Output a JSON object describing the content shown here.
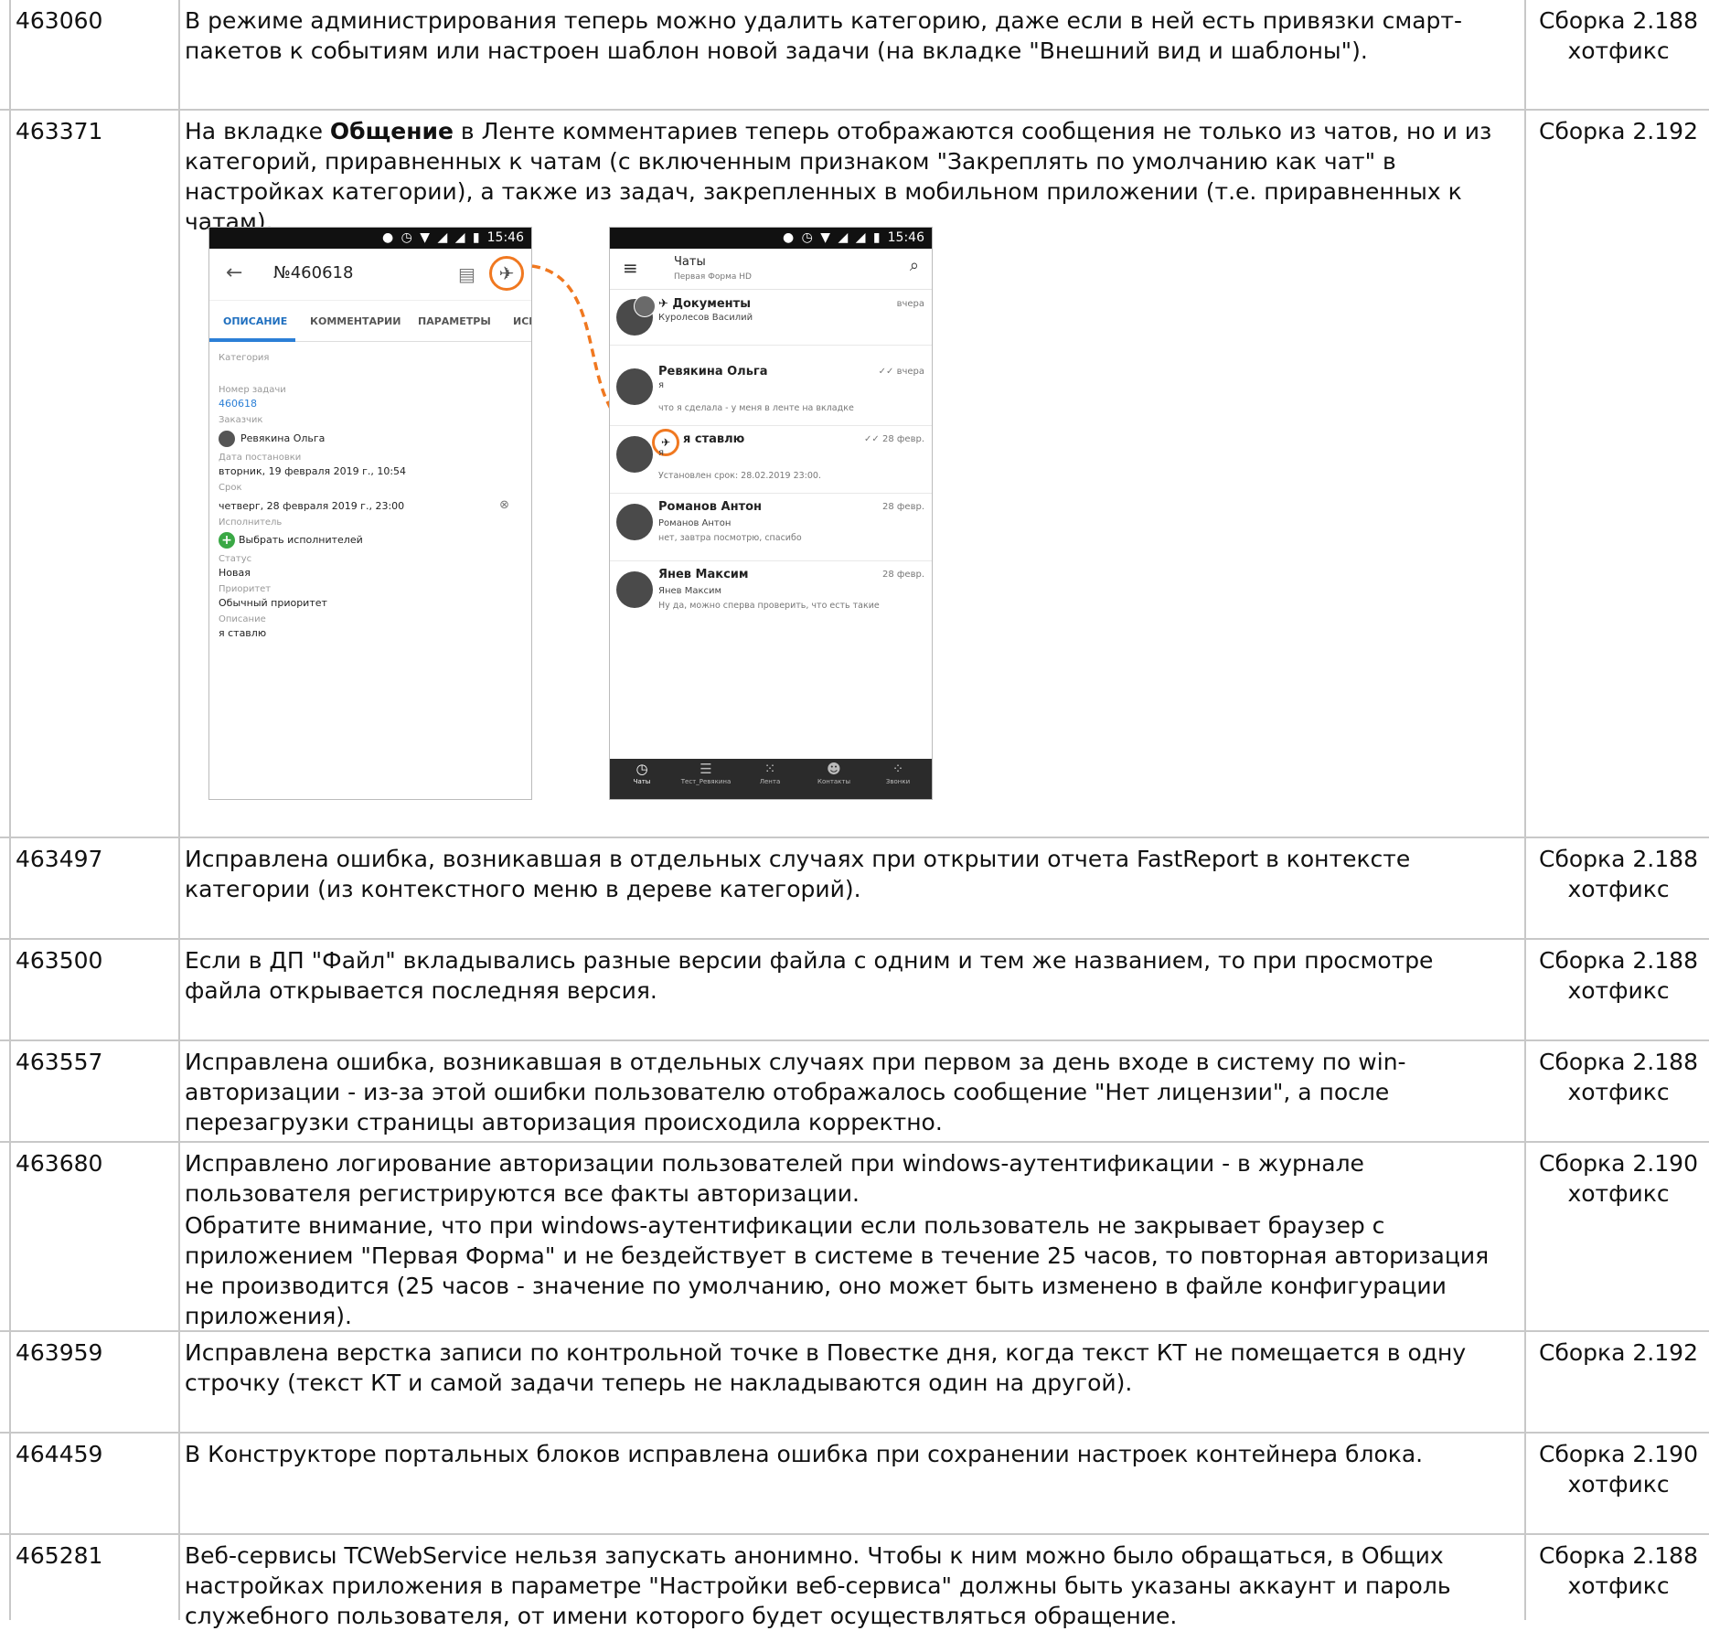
{
  "rows": [
    {
      "id": "463060",
      "desc": [
        "В режиме администрирования теперь можно удалить категорию, даже если в ней есть привязки смарт-пакетов к событиям или настроен шаблон новой задачи (на вкладке \"Внешний вид и шаблоны\")."
      ],
      "build": "Сборка 2.188",
      "note": "хотфикс"
    },
    {
      "id": "463371",
      "desc_pre": "На вкладке ",
      "desc_bold": "Общение",
      "desc_post": " в Ленте комментариев теперь отображаются сообщения не только из чатов, но и из категорий, приравненных к чатам (с включенным признаком \"Закреплять по умолчанию как чат\" в настройках категории), а также из задач, закрепленных в мобильном приложении (т.е. приравненных к чатам).",
      "build": "Сборка 2.192",
      "note": ""
    },
    {
      "id": "463497",
      "desc": [
        "Исправлена ошибка, возникавшая в отдельных случаях при открытии отчета FastReport в контексте категории (из контекстного меню в дереве категорий)."
      ],
      "build": "Сборка 2.188",
      "note": "хотфикс"
    },
    {
      "id": "463500",
      "desc": [
        "Если в ДП \"Файл\" вкладывались разные версии файла с одним и тем же названием, то при просмотре файла открывается последняя версия."
      ],
      "build": "Сборка 2.188",
      "note": "хотфикс"
    },
    {
      "id": "463557",
      "desc": [
        "Исправлена ошибка, возникавшая в отдельных случаях при первом за день входе в систему по win-авторизации - из-за этой ошибки пользователю отображалось сообщение \"Нет лицензии\", а после перезагрузки страницы авторизация происходила корректно."
      ],
      "build": "Сборка 2.188",
      "note": "хотфикс"
    },
    {
      "id": "463680",
      "desc": [
        "Исправлено логирование авторизации пользователей при windows-аутентификации - в журнале пользователя регистрируются все факты авторизации.",
        "Обратите внимание, что при windows-аутентификации если пользователь не закрывает браузер с приложением \"Первая Форма\" и не бездействует в системе в течение 25 часов, то повторная авторизация не производится (25 часов - значение по умолчанию, оно может быть изменено в файле конфигурации приложения)."
      ],
      "build": "Сборка 2.190",
      "note": "хотфикс"
    },
    {
      "id": "463959",
      "desc": [
        "Исправлена верстка записи по контрольной точке в Повестке дня, когда текст КТ не помещается в одну строчку (текст КТ и самой задачи теперь не накладываются один на другой)."
      ],
      "build": "Сборка 2.192",
      "note": ""
    },
    {
      "id": "464459",
      "desc": [
        "В Конструкторе портальных блоков исправлена ошибка при сохранении настроек контейнера блока."
      ],
      "build": "Сборка 2.190",
      "note": "хотфикс"
    },
    {
      "id": "465281",
      "desc": [
        "Веб-сервисы TCWebService нельзя запускать анонимно. Чтобы к ним можно было обращаться, в Общих настройках приложения в параметре \"Настройки веб-сервиса\" должны быть указаны аккаунт и пароль служебного пользователя, от имени которого будет осуществляться обращение."
      ],
      "build": "Сборка 2.188",
      "note": "хотфикс"
    }
  ],
  "phone_task": {
    "time": "15:46",
    "title": "№460618",
    "tabs": [
      "ОПИСАНИЕ",
      "КОММЕНТАРИИ",
      "ПАРАМЕТРЫ",
      "ИСП"
    ],
    "fields": [
      {
        "label": "Категория",
        "value": ""
      },
      {
        "label": "Номер задачи",
        "value": "460618"
      },
      {
        "label": "Заказчик",
        "value": "Ревякина Ольга"
      },
      {
        "label": "Дата постановки",
        "value": "вторник, 19 февраля 2019 г., 10:54"
      },
      {
        "label": "Срок",
        "value": "четверг, 28 февраля 2019 г., 23:00"
      },
      {
        "label": "Исполнитель",
        "value": "Выбрать исполнителей"
      },
      {
        "label": "Статус",
        "value": "Новая"
      },
      {
        "label": "Приоритет",
        "value": "Обычный приоритет"
      },
      {
        "label": "Описание",
        "value": "я ставлю"
      }
    ],
    "accent": "#f07820"
  },
  "phone_chats": {
    "time": "15:46",
    "title": "Чаты",
    "subtitle": "Первая Форма HD",
    "chats": [
      {
        "name": "Документы",
        "time": "вчера",
        "line2": "Куролесов Василий",
        "line3": ""
      },
      {
        "name": "Ревякина Ольга",
        "time": "вчера",
        "line2": "я",
        "line3": "что я сделала - у меня в ленте на вкладке"
      },
      {
        "name": "я ставлю",
        "time": "28 февр.",
        "line2": "я",
        "line3": "Установлен срок: 28.02.2019 23:00."
      },
      {
        "name": "Романов Антон",
        "time": "28 февр.",
        "line2": "Романов Антон",
        "line3": "нет, завтра посмотрю, спасибо"
      },
      {
        "name": "Янев Максим",
        "time": "28 февр.",
        "line2": "Янев Максим",
        "line3": "Ну да, можно сперва проверить, что есть такие"
      }
    ],
    "nav": [
      "Чаты",
      "Тест_Ревякина",
      "Лента",
      "Контакты",
      "Звонки"
    ]
  }
}
